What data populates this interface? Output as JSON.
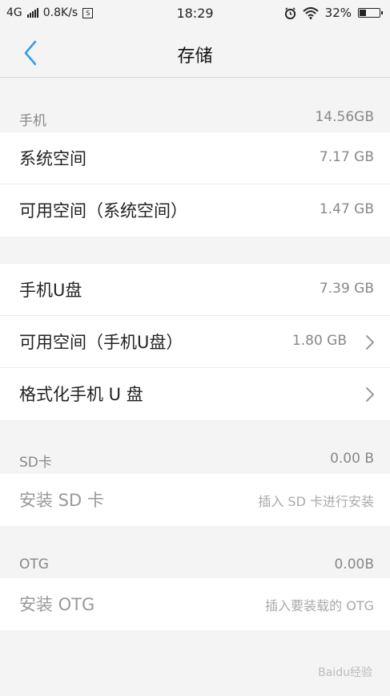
{
  "status_bar": {
    "network": "4G",
    "speed": "0.8K/s",
    "speed_icon_glyph": "S",
    "time": "18:29",
    "battery": "32%"
  },
  "nav": {
    "title": "存储"
  },
  "phone": {
    "header_label": "手机",
    "header_value": "14.56GB",
    "rows": [
      {
        "title": "系统空间",
        "value": "7.17 GB"
      },
      {
        "title": "可用空间（系统空间）",
        "value": "1.47 GB"
      }
    ]
  },
  "udisk": {
    "rows": [
      {
        "title": "手机U盘",
        "value": "7.39 GB"
      },
      {
        "title": "可用空间（手机U盘）",
        "value": "1.80 GB"
      },
      {
        "title": "格式化手机 U 盘",
        "value": ""
      }
    ]
  },
  "sd": {
    "header_label": "SD卡",
    "header_value": "0.00 B",
    "rows": [
      {
        "title": "安装 SD 卡",
        "value": "插入 SD 卡进行安装"
      }
    ]
  },
  "otg": {
    "header_label": "OTG",
    "header_value": "0.00B",
    "rows": [
      {
        "title": "安装 OTG",
        "value": "插入要装载的 OTG"
      }
    ]
  },
  "watermark": "Baidu经验",
  "colors": {
    "accent": "#2d9ee8",
    "background": "#f4f4f4",
    "card": "#ffffff",
    "muted": "#888888"
  }
}
